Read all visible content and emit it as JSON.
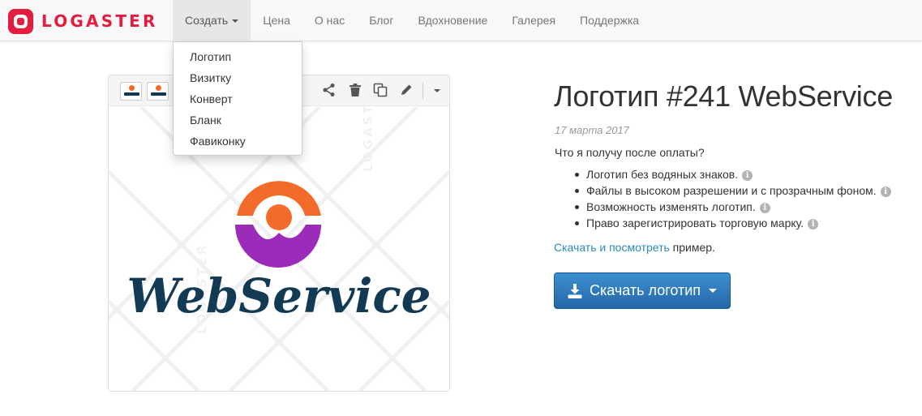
{
  "brand": {
    "name": "LOGASTER",
    "color": "#e31d3f"
  },
  "nav": {
    "items": [
      {
        "label": "Создать",
        "active": true,
        "has_caret": true
      },
      {
        "label": "Цена"
      },
      {
        "label": "О нас"
      },
      {
        "label": "Блог"
      },
      {
        "label": "Вдохновение"
      },
      {
        "label": "Галерея"
      },
      {
        "label": "Поддержка"
      }
    ]
  },
  "create_menu": {
    "items": [
      "Логотип",
      "Визитку",
      "Конверт",
      "Бланк",
      "Фавиконку"
    ]
  },
  "preview": {
    "logo_text": "WebService",
    "watermark_text": "LOGASTER",
    "toolbar_icons": [
      "share-icon",
      "trash-icon",
      "copy-icon",
      "pencil-icon",
      "chevron-down-icon"
    ],
    "colors": {
      "orange": "#f26b2a",
      "purple": "#9b2bb8",
      "navy": "#123a54"
    }
  },
  "product": {
    "title": "Логотип #241 WebService",
    "date": "17 марта 2017",
    "question": "Что я получу после оплаты?",
    "features": [
      "Логотип без водяных знаков.",
      "Файлы в высоком разрешении и с прозрачным фоном.",
      "Возможность изменять логотип.",
      "Право зарегистрировать торговую марку."
    ],
    "info_glyph": "i",
    "sample_link": "Скачать и посмотреть",
    "sample_suffix": " пример.",
    "download_button": "Скачать логотип",
    "accent_color": "#2a8ab8"
  }
}
